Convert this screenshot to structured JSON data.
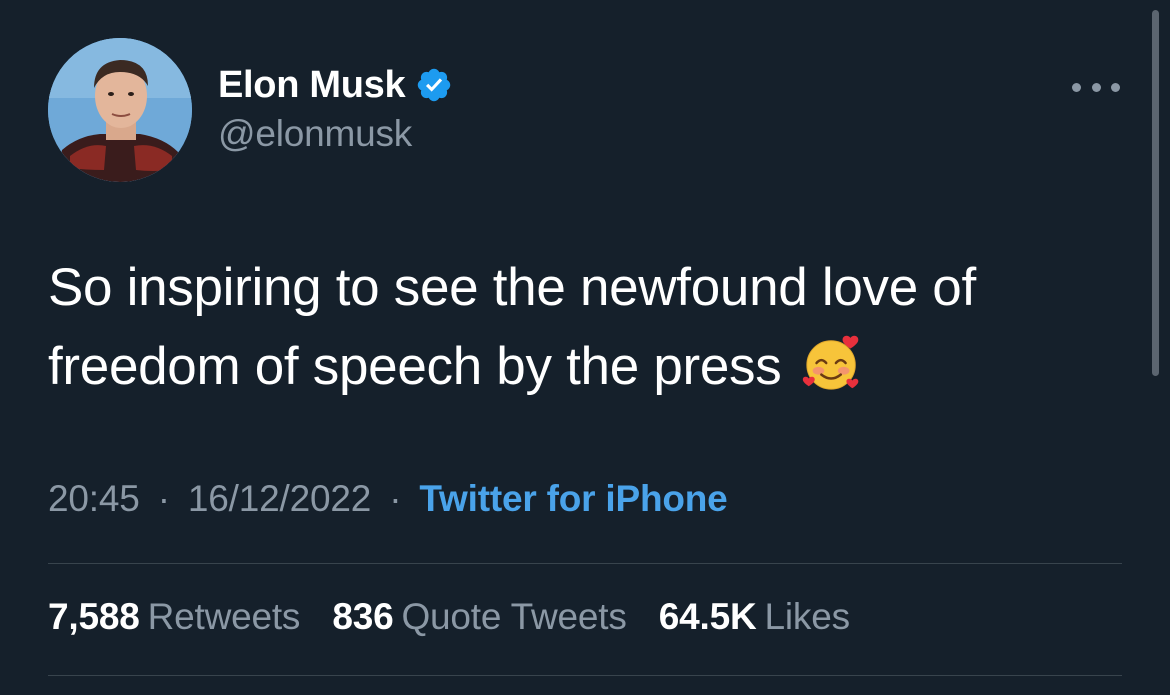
{
  "author": {
    "display_name": "Elon Musk",
    "handle": "@elonmusk",
    "verified_icon": "verified-badge-icon",
    "verified_color": "#1d9bf0"
  },
  "tweet": {
    "text": "So inspiring to see the newfound love of freedom of speech by the press",
    "emoji": "smiling-face-with-hearts-icon"
  },
  "meta": {
    "time": "20:45",
    "separator": "·",
    "date": "16/12/2022",
    "source": "Twitter for iPhone",
    "source_color": "#4aa3ea"
  },
  "stats": {
    "retweets_count": "7,588",
    "retweets_label": "Retweets",
    "quotes_count": "836",
    "quotes_label": "Quote Tweets",
    "likes_count": "64.5K",
    "likes_label": "Likes"
  },
  "colors": {
    "background": "#15202b",
    "secondary_text": "#8b98a5",
    "divider": "#38444d"
  },
  "more_icon": "more-horizontal-icon"
}
